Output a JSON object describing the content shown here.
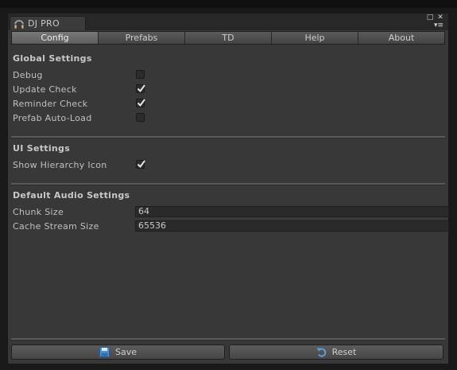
{
  "window": {
    "title": "DJ PRO"
  },
  "tabs": [
    {
      "label": "Config",
      "active": true
    },
    {
      "label": "Prefabs",
      "active": false
    },
    {
      "label": "TD",
      "active": false
    },
    {
      "label": "Help",
      "active": false
    },
    {
      "label": "About",
      "active": false
    }
  ],
  "global_settings": {
    "title": "Global Settings",
    "items": [
      {
        "label": "Debug",
        "checked": false
      },
      {
        "label": "Update Check",
        "checked": true
      },
      {
        "label": "Reminder Check",
        "checked": true
      },
      {
        "label": "Prefab Auto-Load",
        "checked": false
      }
    ]
  },
  "ui_settings": {
    "title": "UI Settings",
    "items": [
      {
        "label": "Show Hierarchy Icon",
        "checked": true
      }
    ]
  },
  "audio_settings": {
    "title": "Default Audio Settings",
    "fields": [
      {
        "label": "Chunk Size",
        "value": "64"
      },
      {
        "label": "Cache Stream Size",
        "value": "65536"
      }
    ]
  },
  "buttons": {
    "save_label": "Save",
    "reset_label": "Reset"
  },
  "icons": {
    "window_icon": "headphones-icon",
    "save_icon": "floppy-disk-icon",
    "reset_icon": "undo-arrow-icon"
  },
  "colors": {
    "accent_icon": "#5a9ee0",
    "panel_bg": "#383838"
  }
}
